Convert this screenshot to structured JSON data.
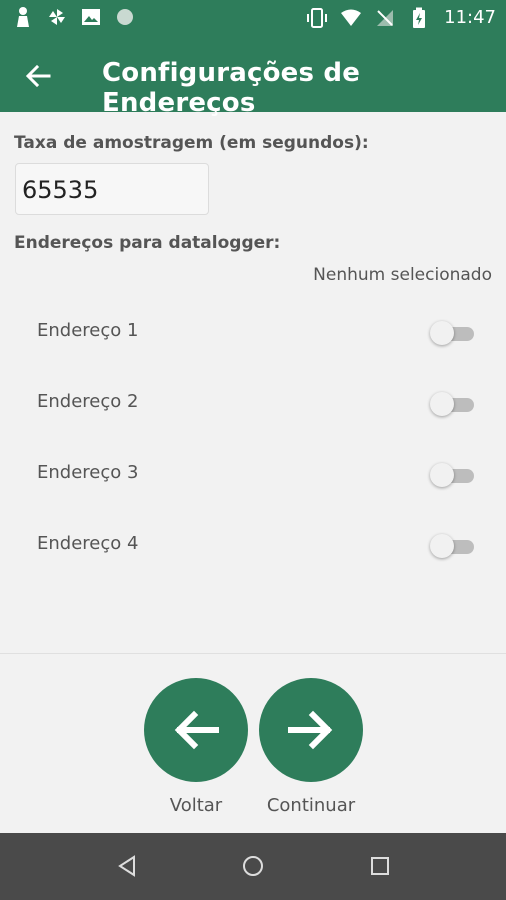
{
  "status_bar": {
    "time": "11:47",
    "left_icons": [
      "keyhole-icon",
      "pinwheel-icon",
      "image-icon",
      "circle-icon"
    ],
    "right_icons": [
      "vibrate-icon",
      "wifi-icon",
      "no-signal-icon",
      "battery-charging-icon"
    ]
  },
  "app_bar": {
    "title": "Configurações de Endereços",
    "back_icon": "arrow-left-icon",
    "color": "#2e7d5b"
  },
  "form": {
    "sampling_label": "Taxa de amostragem (em segundos):",
    "sampling_value": "65535",
    "addresses_label": "Endereços para datalogger:",
    "selection_status": "Nenhum selecionado",
    "addresses": [
      {
        "label": "Endereço 1",
        "enabled": false
      },
      {
        "label": "Endereço 2",
        "enabled": false
      },
      {
        "label": "Endereço 3",
        "enabled": false
      },
      {
        "label": "Endereço 4",
        "enabled": false
      }
    ]
  },
  "actions": {
    "back_label": "Voltar",
    "continue_label": "Continuar"
  }
}
